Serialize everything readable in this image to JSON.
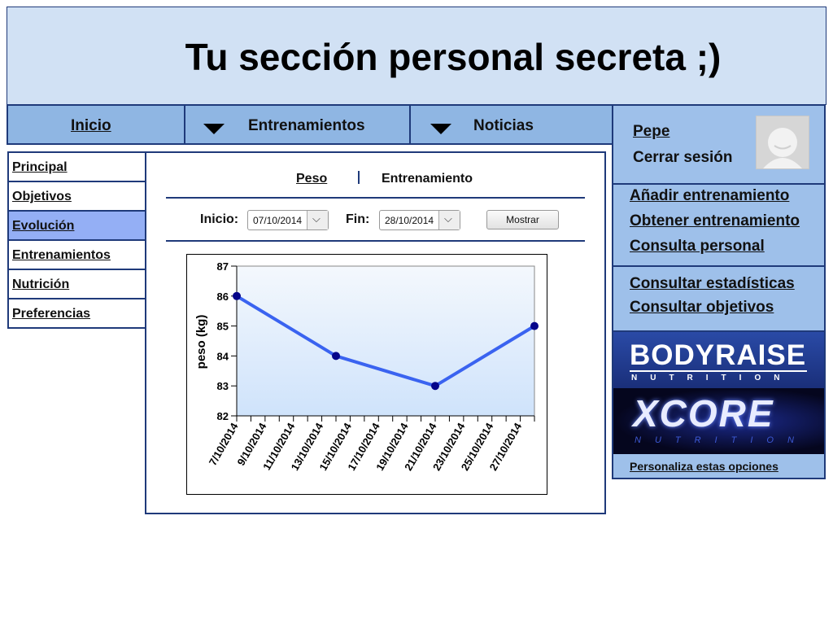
{
  "header": {
    "title": "Tu sección personal secreta ;)"
  },
  "topnav": {
    "inicio": "Inicio",
    "entrenamientos": "Entrenamientos",
    "noticias": "Noticias"
  },
  "leftnav": {
    "items": [
      "Principal",
      "Objetivos",
      "Evolución",
      "Entrenamientos",
      "Nutrición",
      "Preferencias"
    ],
    "active_index": 2
  },
  "main": {
    "tabs": {
      "peso": "Peso",
      "entrenamiento": "Entrenamiento"
    },
    "filter": {
      "inicio_label": "Inicio:",
      "inicio_value": "07/10/2014",
      "fin_label": "Fin:",
      "fin_value": "28/10/2014",
      "mostrar": "Mostrar",
      "dropdown_glyph": "⌵"
    }
  },
  "chart_data": {
    "type": "line",
    "ylabel": "peso (kg)",
    "xlabel": "",
    "ylim": [
      82,
      87
    ],
    "yticks": [
      82,
      83,
      84,
      85,
      86,
      87
    ],
    "x_tick_labels": [
      "7/10/2014",
      "9/10/2014",
      "11/10/2014",
      "13/10/2014",
      "15/10/2014",
      "17/10/2014",
      "19/10/2014",
      "21/10/2014",
      "23/10/2014",
      "25/10/2014",
      "27/10/2014"
    ],
    "x_day_range": [
      7,
      28
    ],
    "series": [
      {
        "values": [
          {
            "x": "7/10/2014",
            "y": 86
          },
          {
            "x": "14/10/2014",
            "y": 84
          },
          {
            "x": "21/10/2014",
            "y": 83
          },
          {
            "x": "28/10/2014",
            "y": 85
          }
        ]
      }
    ],
    "colors": {
      "line": "#3a63f0",
      "marker": "#05058a"
    },
    "grid": false
  },
  "side": {
    "user": "Pepe",
    "logout": "Cerrar sesión",
    "links1": [
      "Añadir entrenamiento",
      "Obtener entrenamiento",
      "Consulta personal"
    ],
    "links2": [
      "Consultar estadísticas",
      "Consultar objetivos"
    ],
    "banners": {
      "bodyraise": {
        "title": "BODYRAISE",
        "sub": "NUTRITION"
      },
      "xcore": {
        "title": "XCORE",
        "sub": "NUTRITION"
      }
    },
    "personaliza": "Personaliza estas opciones"
  }
}
